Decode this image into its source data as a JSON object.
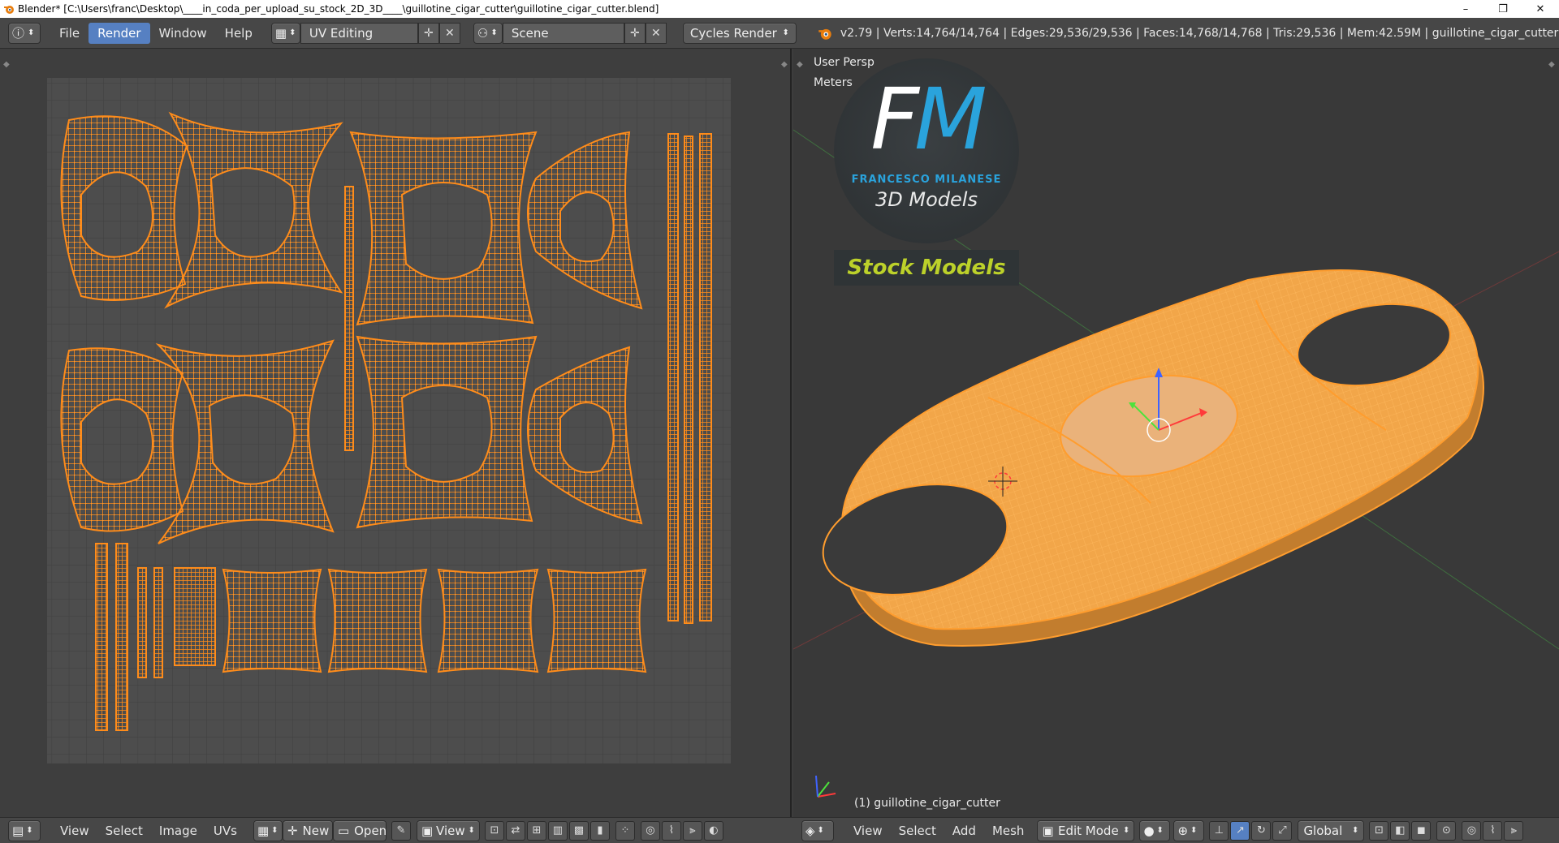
{
  "titlebar": {
    "title": "Blender* [C:\\Users\\franc\\Desktop\\____in_coda_per_upload_su_stock_2D_3D____\\guillotine_cigar_cutter\\guillotine_cigar_cutter.blend]",
    "minimize": "–",
    "restore": "❐",
    "close": "✕"
  },
  "infobar": {
    "menus": [
      "File",
      "Render",
      "Window",
      "Help"
    ],
    "active_menu": "Render",
    "layout": "UV Editing",
    "scene": "Scene",
    "engine": "Cycles Render",
    "stats": "v2.79 | Verts:14,764/14,764 | Edges:29,536/29,536 | Faces:14,768/14,768 | Tris:29,536 | Mem:42.59M | guillotine_cigar_cutter"
  },
  "uv_footer": {
    "items": [
      "View",
      "Select",
      "Image",
      "UVs"
    ],
    "new_label": "New",
    "open_label": "Open",
    "view_label": "View"
  },
  "viewport": {
    "persp": "User Persp",
    "units": "Meters",
    "object": "(1) guillotine_cigar_cutter"
  },
  "logo": {
    "F": "F",
    "M": "M",
    "name": "FRANCESCO MILANESE",
    "sub": "3D Models",
    "stock": "Stock Models"
  },
  "v3_footer": {
    "items": [
      "View",
      "Select",
      "Add",
      "Mesh"
    ],
    "mode": "Edit Mode",
    "orientation": "Global"
  },
  "colors": {
    "uv_orange": "#ff8c1a",
    "mesh_orange": "#f2a649",
    "accent_blue": "#5680c2"
  }
}
